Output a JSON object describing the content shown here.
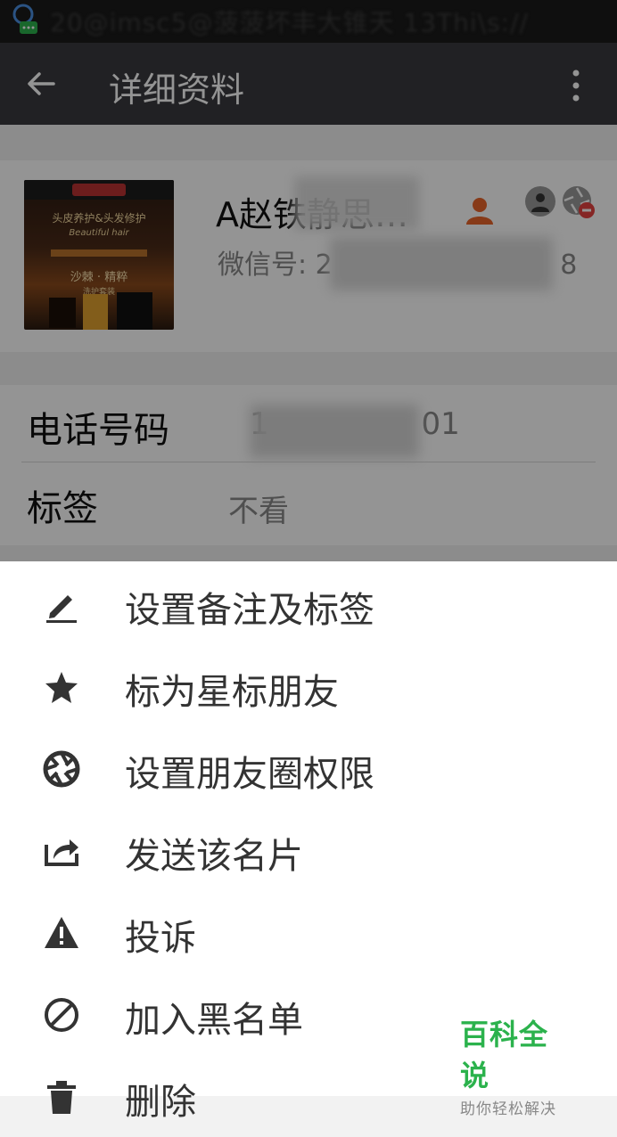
{
  "status_bar": {
    "text": "20@imsc5@菠菠坏丰大锥天 13Thi\\s://"
  },
  "titlebar": {
    "title": "详细资料"
  },
  "profile": {
    "nickname": "A赵铁静思…",
    "wechat_id": "微信号: 2",
    "wechat_id_suffix": "8",
    "avatar_text": {
      "line1": "头皮养护&头发修护",
      "line2": "Beautiful hair",
      "line3": "沙棘 · 精粹",
      "line4": "洗护套装"
    }
  },
  "info": {
    "rows": [
      {
        "label": "电话号码",
        "value": "1",
        "value_suffix": "01"
      },
      {
        "label": "标签",
        "value": "不看"
      }
    ]
  },
  "menu": {
    "items": [
      {
        "label": "设置备注及标签",
        "icon": "pencil-icon"
      },
      {
        "label": "标为星标朋友",
        "icon": "star-icon"
      },
      {
        "label": "设置朋友圈权限",
        "icon": "moments-aperture-icon"
      },
      {
        "label": "发送该名片",
        "icon": "share-icon"
      },
      {
        "label": "投诉",
        "icon": "warning-icon"
      },
      {
        "label": "加入黑名单",
        "icon": "block-icon"
      },
      {
        "label": "删除",
        "icon": "trash-icon"
      }
    ]
  },
  "watermark": {
    "title": "百科全说",
    "subtitle": "助你轻松解决"
  },
  "colors": {
    "title_bar": "#393a3f",
    "accent_green": "#2bb24c",
    "badge_red": "#e64340",
    "person_orange": "#e8652a"
  }
}
